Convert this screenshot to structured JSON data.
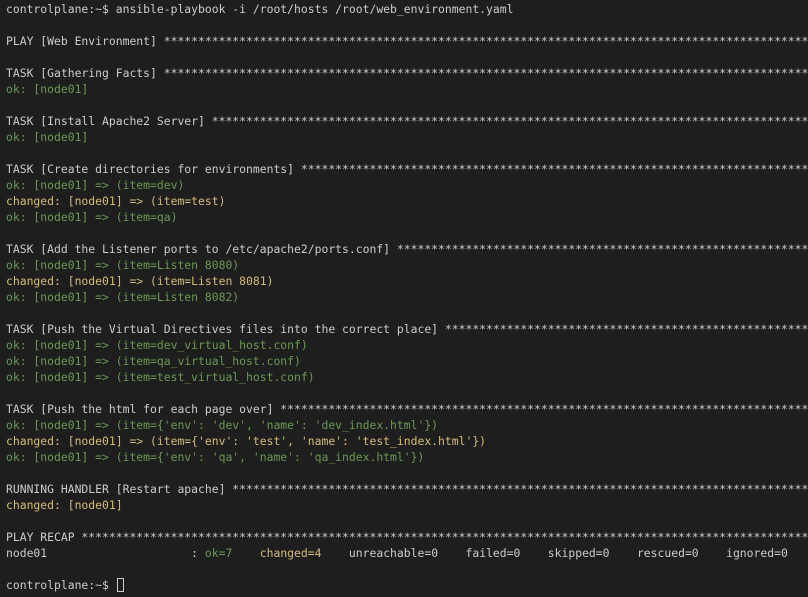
{
  "colors": {
    "background": "#1e1e1e",
    "text": "#cccccc",
    "ok": "#6a9955",
    "changed": "#d7ba7d"
  },
  "command": "controlplane:~$ ansible-playbook -i /root/hosts /root/web_environment.yaml",
  "output": [
    {
      "t": "blank",
      "text": ""
    },
    {
      "t": "header",
      "text": "PLAY [Web Environment] *************************************************************************************************************"
    },
    {
      "t": "blank",
      "text": ""
    },
    {
      "t": "header",
      "text": "TASK [Gathering Facts] *************************************************************************************************************"
    },
    {
      "t": "ok",
      "text": "ok: [node01]"
    },
    {
      "t": "blank",
      "text": ""
    },
    {
      "t": "header",
      "text": "TASK [Install Apache2 Server] ******************************************************************************************************"
    },
    {
      "t": "ok",
      "text": "ok: [node01]"
    },
    {
      "t": "blank",
      "text": ""
    },
    {
      "t": "header",
      "text": "TASK [Create directories for environments] *****************************************************************************************"
    },
    {
      "t": "ok",
      "text": "ok: [node01] => (item=dev)"
    },
    {
      "t": "changed",
      "text": "changed: [node01] => (item=test)"
    },
    {
      "t": "ok",
      "text": "ok: [node01] => (item=qa)"
    },
    {
      "t": "blank",
      "text": ""
    },
    {
      "t": "header",
      "text": "TASK [Add the Listener ports to /etc/apache2/ports.conf] ***************************************************************************"
    },
    {
      "t": "ok",
      "text": "ok: [node01] => (item=Listen 8080)"
    },
    {
      "t": "changed",
      "text": "changed: [node01] => (item=Listen 8081)"
    },
    {
      "t": "ok",
      "text": "ok: [node01] => (item=Listen 8082)"
    },
    {
      "t": "blank",
      "text": ""
    },
    {
      "t": "header",
      "text": "TASK [Push the Virtual Directives files into the correct place] ********************************************************************"
    },
    {
      "t": "ok",
      "text": "ok: [node01] => (item=dev_virtual_host.conf)"
    },
    {
      "t": "ok",
      "text": "ok: [node01] => (item=qa_virtual_host.conf)"
    },
    {
      "t": "ok",
      "text": "ok: [node01] => (item=test_virtual_host.conf)"
    },
    {
      "t": "blank",
      "text": ""
    },
    {
      "t": "header",
      "text": "TASK [Push the html for each page over] ********************************************************************************************"
    },
    {
      "t": "ok",
      "text": "ok: [node01] => (item={'env': 'dev', 'name': 'dev_index.html'})"
    },
    {
      "t": "changed",
      "text": "changed: [node01] => (item={'env': 'test', 'name': 'test_index.html'})"
    },
    {
      "t": "ok",
      "text": "ok: [node01] => (item={'env': 'qa', 'name': 'qa_index.html'})"
    },
    {
      "t": "blank",
      "text": ""
    },
    {
      "t": "header",
      "text": "RUNNING HANDLER [Restart apache] ***************************************************************************************************"
    },
    {
      "t": "changed",
      "text": "changed: [node01]"
    },
    {
      "t": "blank",
      "text": ""
    },
    {
      "t": "header",
      "text": "PLAY RECAP *************************************************************************************************************************"
    }
  ],
  "recap": {
    "host": "node01                     : ",
    "ok": "ok=7",
    "gap1": "    ",
    "changed": "changed=4",
    "rest": "    unreachable=0    failed=0    skipped=0    rescued=0    ignored=0"
  },
  "prompt": "controlplane:~$ "
}
